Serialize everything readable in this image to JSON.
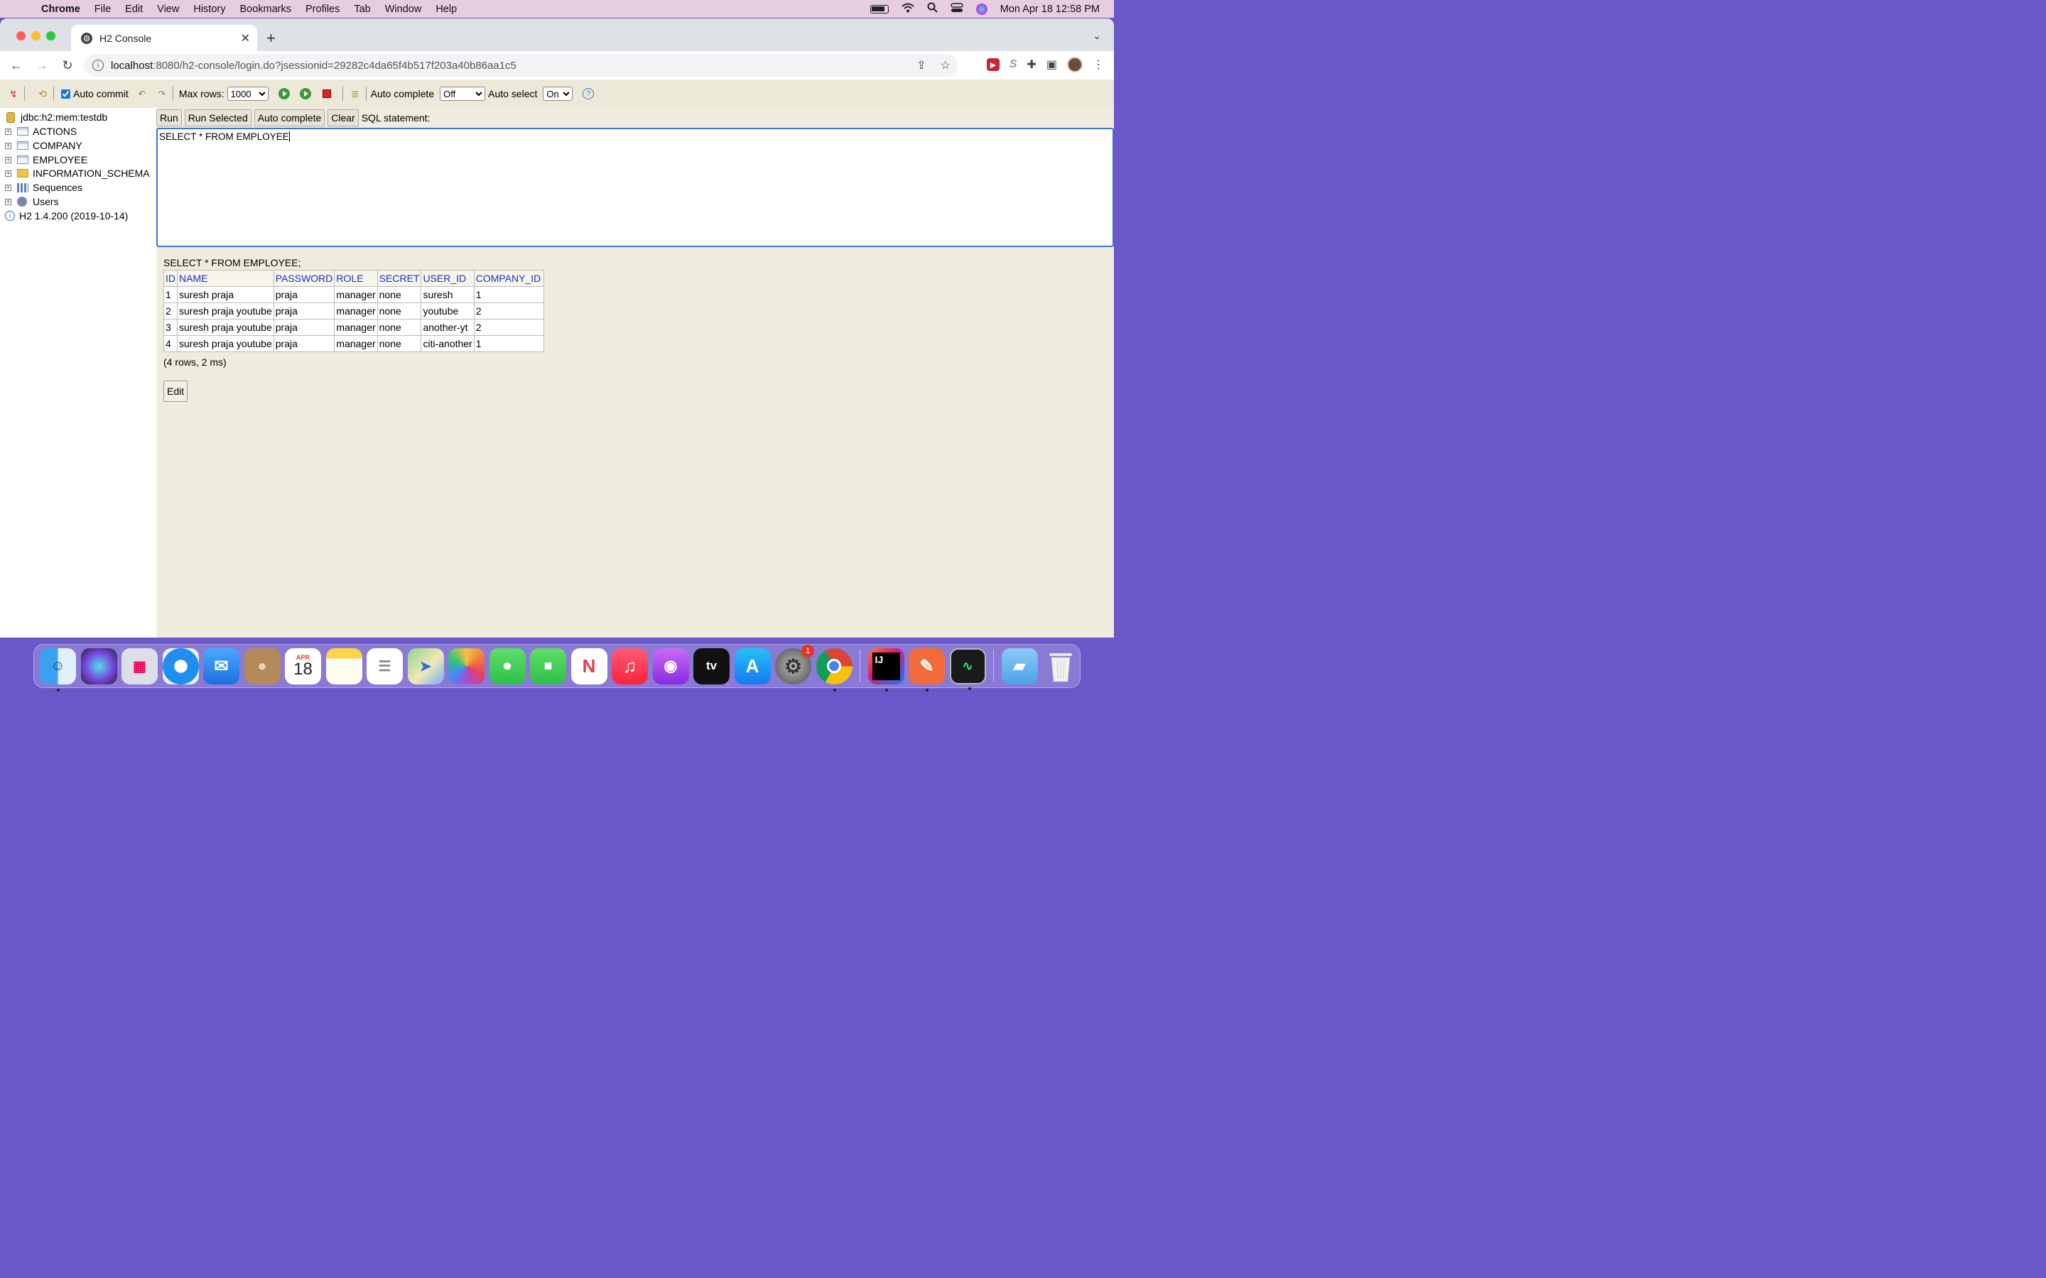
{
  "menubar": {
    "app": "Chrome",
    "items": [
      "File",
      "Edit",
      "View",
      "History",
      "Bookmarks",
      "Profiles",
      "Tab",
      "Window",
      "Help"
    ],
    "datetime": "Mon Apr 18  12:58 PM"
  },
  "browser": {
    "tab_title": "H2 Console",
    "url_host": "localhost",
    "url_rest": ":8080/h2-console/login.do?jsessionid=29282c4da65f4b517f203a40b86aa1c5"
  },
  "h2toolbar": {
    "auto_commit_label": "Auto commit",
    "auto_commit_checked": true,
    "max_rows_label": "Max rows:",
    "max_rows_value": "1000",
    "auto_complete_label": "Auto complete",
    "auto_complete_value": "Off",
    "auto_select_label": "Auto select",
    "auto_select_value": "On"
  },
  "tree": {
    "connection": "jdbc:h2:mem:testdb",
    "items": [
      "ACTIONS",
      "COMPANY",
      "EMPLOYEE",
      "INFORMATION_SCHEMA",
      "Sequences",
      "Users"
    ],
    "version": "H2 1.4.200 (2019-10-14)"
  },
  "query": {
    "buttons": [
      "Run",
      "Run Selected",
      "Auto complete",
      "Clear"
    ],
    "statement_label": "SQL statement:",
    "sql": "SELECT * FROM EMPLOYEE "
  },
  "result": {
    "executed": "SELECT * FROM EMPLOYEE;",
    "columns": [
      "ID",
      "NAME",
      "PASSWORD",
      "ROLE",
      "SECRET",
      "USER_ID",
      "COMPANY_ID"
    ],
    "rows": [
      [
        "1",
        "suresh praja",
        "praja",
        "manager",
        "none",
        "suresh",
        "1"
      ],
      [
        "2",
        "suresh praja youtube",
        "praja",
        "manager",
        "none",
        "youtube",
        "2"
      ],
      [
        "3",
        "suresh praja youtube",
        "praja",
        "manager",
        "none",
        "another-yt",
        "2"
      ],
      [
        "4",
        "suresh praja youtube",
        "praja",
        "manager",
        "none",
        "citi-another",
        "1"
      ]
    ],
    "summary": "(4 rows, 2 ms)",
    "edit_label": "Edit"
  },
  "dock": {
    "calendar_month": "APR",
    "calendar_day": "18",
    "appletv_label": "tv",
    "intellij_label": "IJ",
    "settings_badge": "1"
  }
}
